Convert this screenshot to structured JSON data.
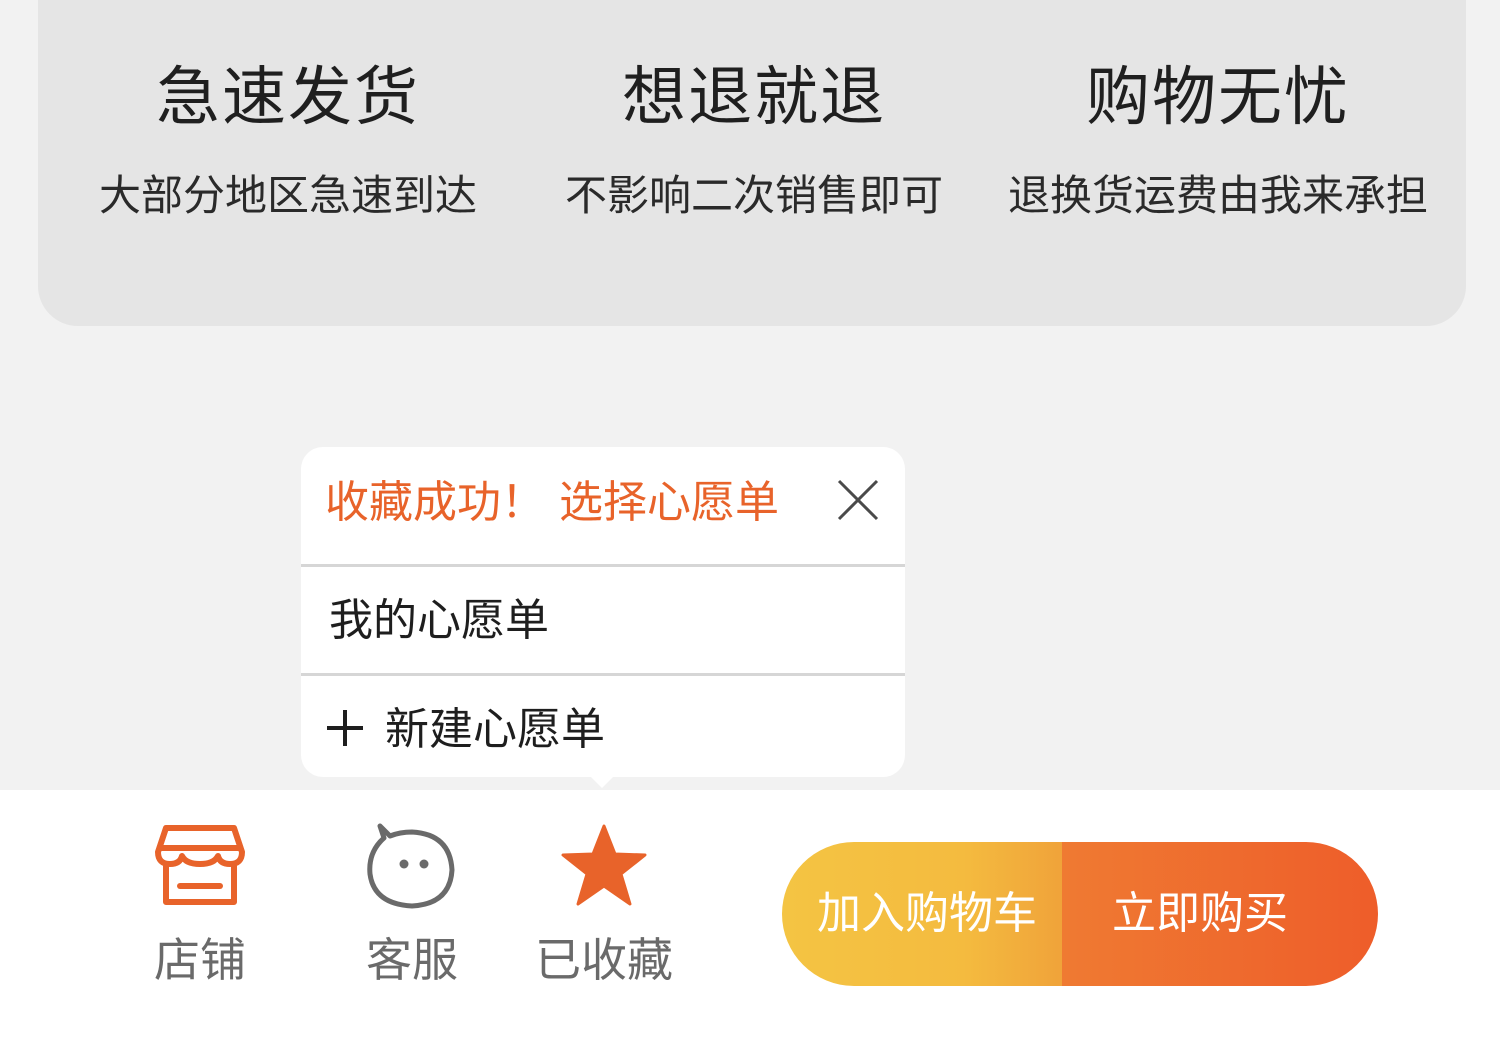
{
  "guarantees": [
    {
      "title": "急速发货",
      "subtitle": "大部分地区急速到达"
    },
    {
      "title": "想退就退",
      "subtitle": "不影响二次销售即可"
    },
    {
      "title": "购物无忧",
      "subtitle": "退换货运费由我来承担"
    }
  ],
  "popover": {
    "title": "收藏成功！ 选择心愿单",
    "close_icon": "close-icon",
    "items": [
      {
        "label": "我的心愿单"
      },
      {
        "label": "新建心愿单",
        "icon": "plus-icon"
      }
    ]
  },
  "bottom_bar": {
    "tabs": [
      {
        "label": "店铺",
        "icon": "store-icon"
      },
      {
        "label": "客服",
        "icon": "chat-face-icon"
      },
      {
        "label": "已收藏",
        "icon": "star-icon"
      }
    ],
    "add_to_cart": "加入购物车",
    "buy_now": "立即购买"
  },
  "colors": {
    "accent": "#e8632a",
    "cart_button": "#f4c443",
    "buy_button": "#ee5d2a"
  }
}
